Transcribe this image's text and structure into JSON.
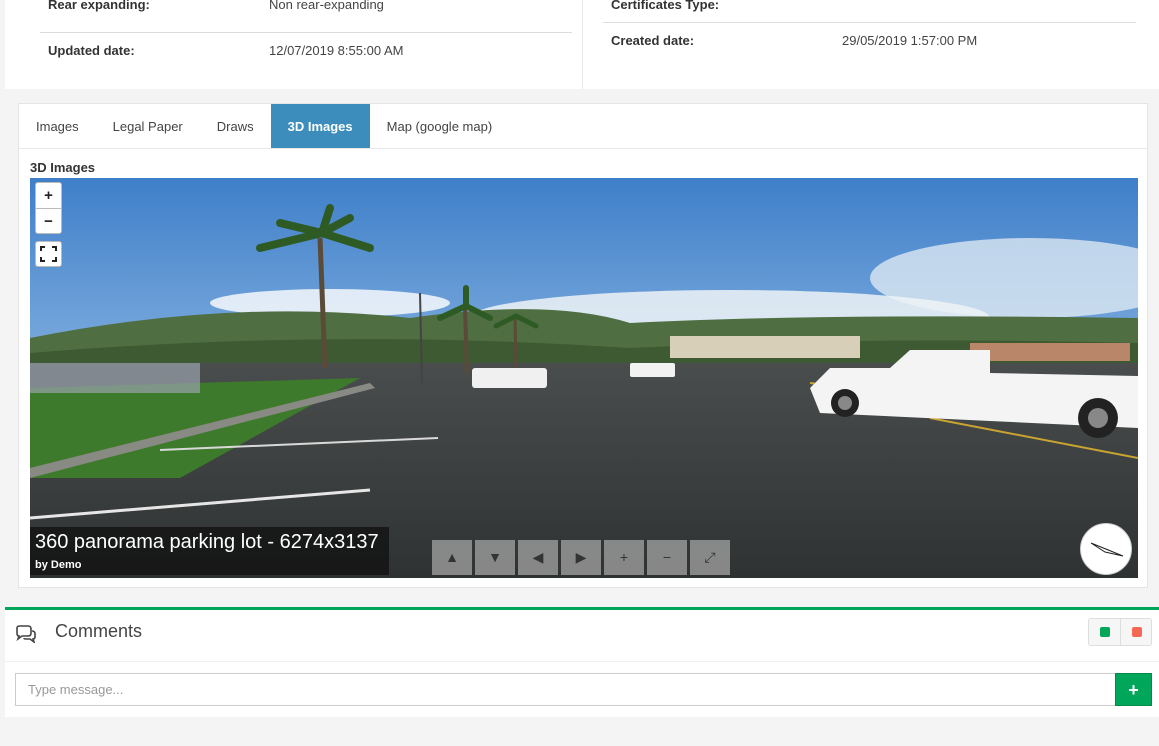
{
  "details": {
    "rear_expanding_label": "Rear expanding:",
    "rear_expanding_value": "Non rear-expanding",
    "updated_date_label": "Updated date:",
    "updated_date_value": "12/07/2019 8:55:00 AM",
    "certificates_type_label": "Certificates Type:",
    "created_date_label": "Created date:",
    "created_date_value": "29/05/2019 1:57:00 PM"
  },
  "tabs": [
    {
      "label": "Images",
      "active": false
    },
    {
      "label": "Legal Paper",
      "active": false
    },
    {
      "label": "Draws",
      "active": false
    },
    {
      "label": "3D Images",
      "active": true
    },
    {
      "label": "Map (google map)",
      "active": false
    }
  ],
  "section_title": "3D Images",
  "panorama": {
    "title": "360 panorama parking lot - 6274x3137",
    "byline": "by Demo",
    "zoom_in": "+",
    "zoom_out": "−",
    "nav_buttons": [
      "▲",
      "▼",
      "◀",
      "▶",
      "+",
      "−",
      "⤢"
    ]
  },
  "comments": {
    "title": "Comments",
    "input_placeholder": "Type message...",
    "add_label": "+"
  },
  "colors": {
    "active_tab": "#3c8dbc",
    "comments_accent": "#00a65a",
    "tool_green": "#00a65a",
    "tool_red": "#f56954"
  }
}
